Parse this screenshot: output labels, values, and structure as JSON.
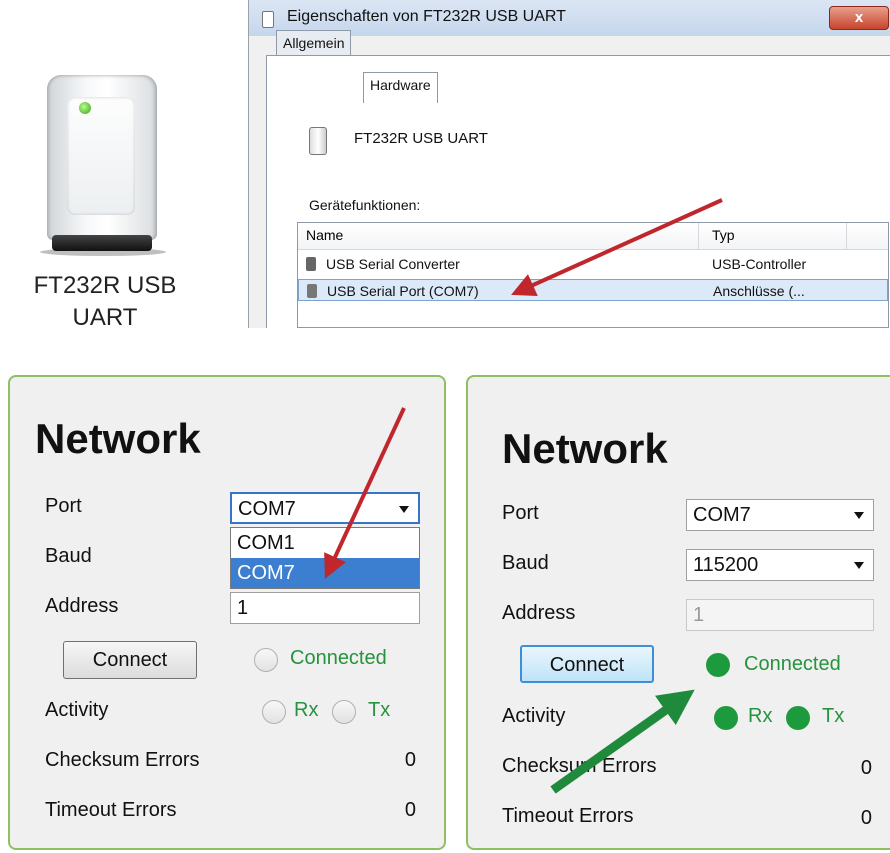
{
  "device": {
    "label_line1": "FT232R USB",
    "label_line2": "UART"
  },
  "dialog": {
    "title": "Eigenschaften von FT232R USB UART",
    "close_glyph": "x",
    "tabs": [
      "Allgemein",
      "Hardware"
    ],
    "active_tab": "Hardware",
    "device_name": "FT232R USB UART",
    "functions_label": "Gerätefunktionen:",
    "columns": [
      "Name",
      "Typ"
    ],
    "rows": [
      {
        "name": "USB Serial Converter",
        "type": "USB-Controller",
        "selected": false
      },
      {
        "name": "USB Serial Port (COM7)",
        "type": "Anschlüsse (...",
        "selected": true
      }
    ]
  },
  "left_panel": {
    "heading": "Network",
    "port_label": "Port",
    "port_value": "COM7",
    "port_options": [
      "COM1",
      "COM7"
    ],
    "port_highlighted": "COM7",
    "baud_label": "Baud",
    "address_label": "Address",
    "address_value": "1",
    "connect_label": "Connect",
    "connected_label": "Connected",
    "activity_label": "Activity",
    "rx_label": "Rx",
    "tx_label": "Tx",
    "checksum_label": "Checksum Errors",
    "checksum_value": "0",
    "timeout_label": "Timeout Errors",
    "timeout_value": "0"
  },
  "right_panel": {
    "heading": "Network",
    "port_label": "Port",
    "port_value": "COM7",
    "baud_label": "Baud",
    "baud_value": "115200",
    "address_label": "Address",
    "address_value": "1",
    "connect_label": "Connect",
    "connected_label": "Connected",
    "activity_label": "Activity",
    "rx_label": "Rx",
    "tx_label": "Tx",
    "checksum_label": "Checksum Errors",
    "checksum_value": "0",
    "timeout_label": "Timeout Errors",
    "timeout_value": "0"
  },
  "colors": {
    "panel_border": "#8cc063",
    "led_on": "#1e9a3e",
    "connected_text": "#26933e",
    "arrow_red": "#c0272d",
    "arrow_green": "#1f8a3c"
  }
}
